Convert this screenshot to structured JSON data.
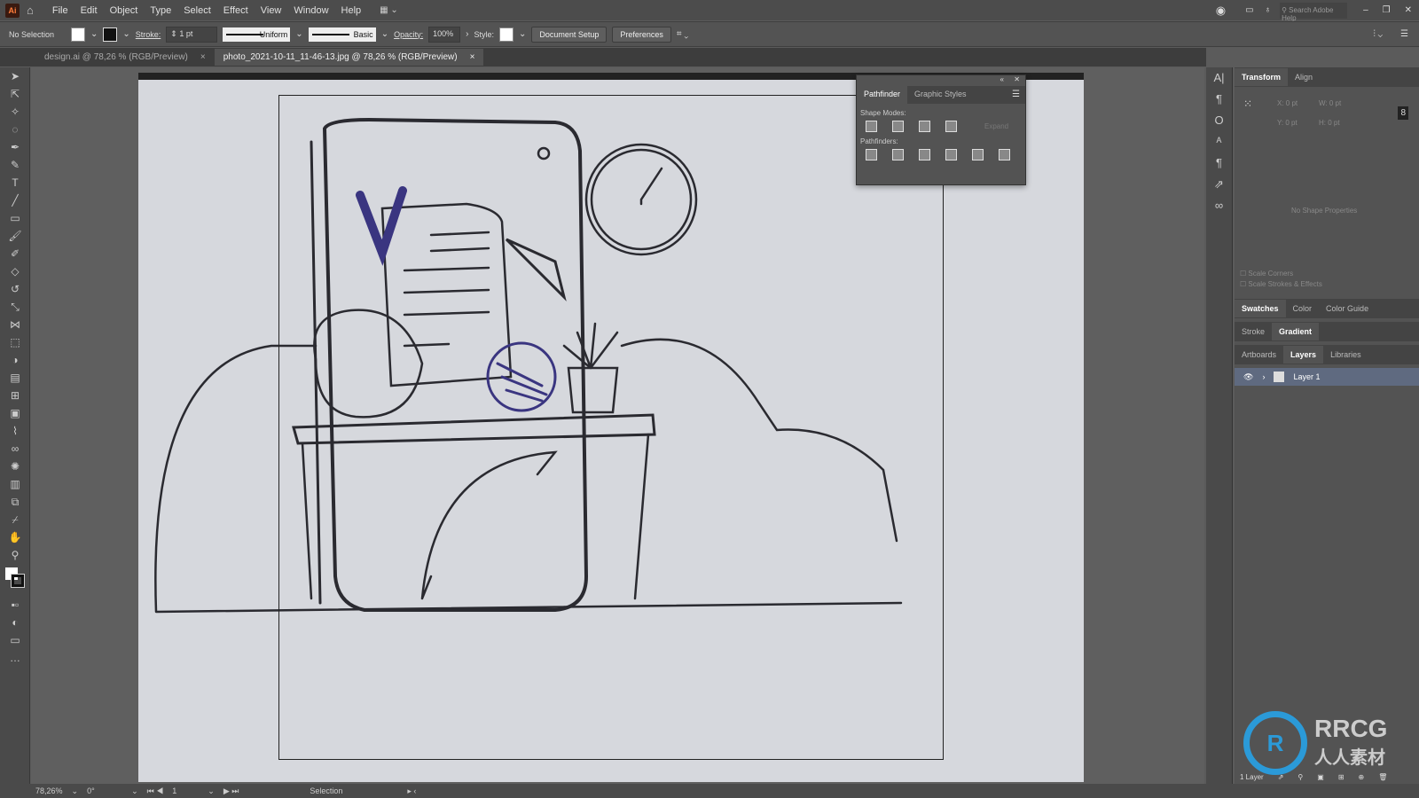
{
  "app": {
    "logo": "Ai"
  },
  "menu": [
    "File",
    "Edit",
    "Object",
    "Type",
    "Select",
    "Effect",
    "View",
    "Window",
    "Help"
  ],
  "titlebar": {
    "search_placeholder": "Search Adobe Help"
  },
  "control": {
    "selection": "No Selection",
    "stroke_label": "Stroke:",
    "stroke_value": "1 pt",
    "profile": "Uniform",
    "brush": "Basic",
    "opacity_label": "Opacity:",
    "opacity_value": "100%",
    "style_label": "Style:",
    "doc_setup": "Document Setup",
    "preferences": "Preferences"
  },
  "tabs": [
    {
      "label": "design.ai @ 78,26 % (RGB/Preview)",
      "close": "×"
    },
    {
      "label": "photo_2021-10-11_11-46-13.jpg @ 78,26 % (RGB/Preview)",
      "close": "×"
    }
  ],
  "pathfinder": {
    "tabs": [
      "Pathfinder",
      "Graphic Styles"
    ],
    "shape_modes": "Shape Modes:",
    "pathfinders": "Pathfinders:",
    "expand": "Expand"
  },
  "transform": {
    "tabs": [
      "Transform",
      "Align"
    ],
    "x": "X: 0 pt",
    "y": "Y: 0 pt",
    "w": "W: 0 pt",
    "h": "H: 0 pt",
    "no_shape": "No Shape Properties",
    "scale_corners": "Scale Corners",
    "scale_strokes": "Scale Strokes & Effects"
  },
  "swatches_tabs": [
    "Swatches",
    "Color",
    "Color Guide"
  ],
  "stroke_tabs": [
    "Stroke",
    "Gradient"
  ],
  "layers_tabs": [
    "Artboards",
    "Layers",
    "Libraries"
  ],
  "layers": [
    {
      "name": "Layer 1"
    }
  ],
  "layers_footer": "1 Layer",
  "status": {
    "zoom": "78,26%",
    "rotation": "0°",
    "artboard": "1",
    "tool": "Selection"
  },
  "watermark": {
    "text": "RRCG",
    "subtext": "人人素材"
  }
}
